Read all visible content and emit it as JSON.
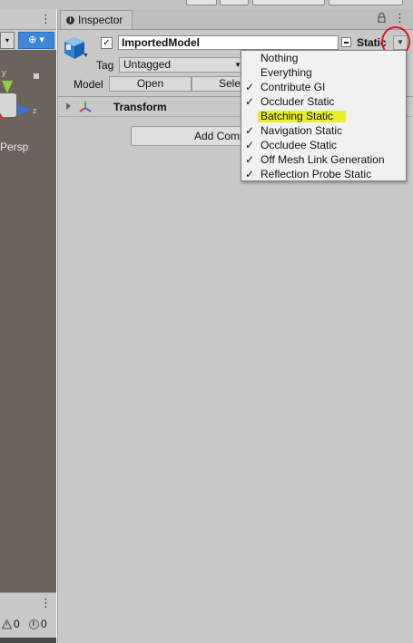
{
  "scene_panel": {
    "more_icon": "vertical-ellipsis-icon",
    "gizmo_axis_y": "y",
    "gizmo_axis_z": "z",
    "view_label": "Persp"
  },
  "hierarchy": {
    "warning_count": "0",
    "error_count": "0"
  },
  "inspector": {
    "tab_label": "Inspector",
    "object_name": "ImportedModel",
    "active_checked": "✓",
    "static_label": "Static",
    "tag_label": "Tag",
    "tag_value": "Untagged",
    "model_label": "Model",
    "open_label": "Open",
    "select_label": "Select",
    "transform_label": "Transform",
    "add_component_label": "Add Component"
  },
  "static_menu": {
    "items": [
      {
        "label": "Nothing",
        "check": ""
      },
      {
        "label": "Everything",
        "check": ""
      },
      {
        "label": "Contribute GI",
        "check": "✓"
      },
      {
        "label": "Occluder Static",
        "check": "✓"
      },
      {
        "label": "Batching Static",
        "check": ""
      },
      {
        "label": "Navigation Static",
        "check": "✓"
      },
      {
        "label": "Occludee Static",
        "check": "✓"
      },
      {
        "label": "Off Mesh Link Generation",
        "check": "✓"
      },
      {
        "label": "Reflection Probe Static",
        "check": "✓"
      }
    ],
    "highlight_color": "#e8ee2a"
  },
  "annotation": {
    "circle_color": "#e5161d"
  }
}
